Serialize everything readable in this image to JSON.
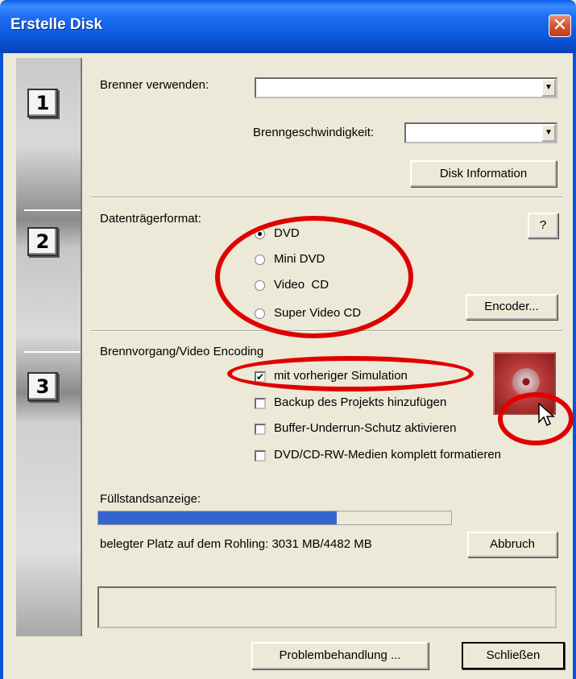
{
  "window": {
    "title": "Erstelle Disk",
    "close_glyph": "✕"
  },
  "steps": [
    "1",
    "2",
    "3"
  ],
  "section1": {
    "brenner_label": "Brenner verwenden:",
    "brenner_value": "",
    "speed_label": "Brenngeschwindigkeit:",
    "speed_value": "",
    "disk_info_button": "Disk Information"
  },
  "section2": {
    "format_label": "Datenträgerformat:",
    "help_button": "?",
    "options": [
      "DVD",
      "Mini DVD",
      "Video  CD",
      "Super Video CD"
    ],
    "selected": "DVD",
    "encoder_button": "Encoder..."
  },
  "section3": {
    "label": "Brennvorgang/Video Encoding",
    "checkboxes": [
      {
        "label": "mit vorheriger Simulation",
        "checked": true
      },
      {
        "label": "Backup des Projekts hinzufügen",
        "checked": false
      },
      {
        "label": "Buffer-Underrun-Schutz aktivieren",
        "checked": false
      },
      {
        "label": "DVD/CD-RW-Medien komplett formatieren",
        "checked": false
      }
    ],
    "burn_icon": "burn-disc-icon"
  },
  "fill": {
    "label": "Füllstandsanzeige:",
    "progress_percent": 67.6,
    "used_text": "belegter Platz auf dem Rohling: 3031 MB/4482 MB",
    "abort_button": "Abbruch"
  },
  "footer": {
    "troubleshoot_button": "Problembehandlung ...",
    "close_button": "Schließen"
  },
  "colors": {
    "titlebar": "#0a54d9",
    "progress": "#3366cc",
    "annotation": "#e00000"
  }
}
